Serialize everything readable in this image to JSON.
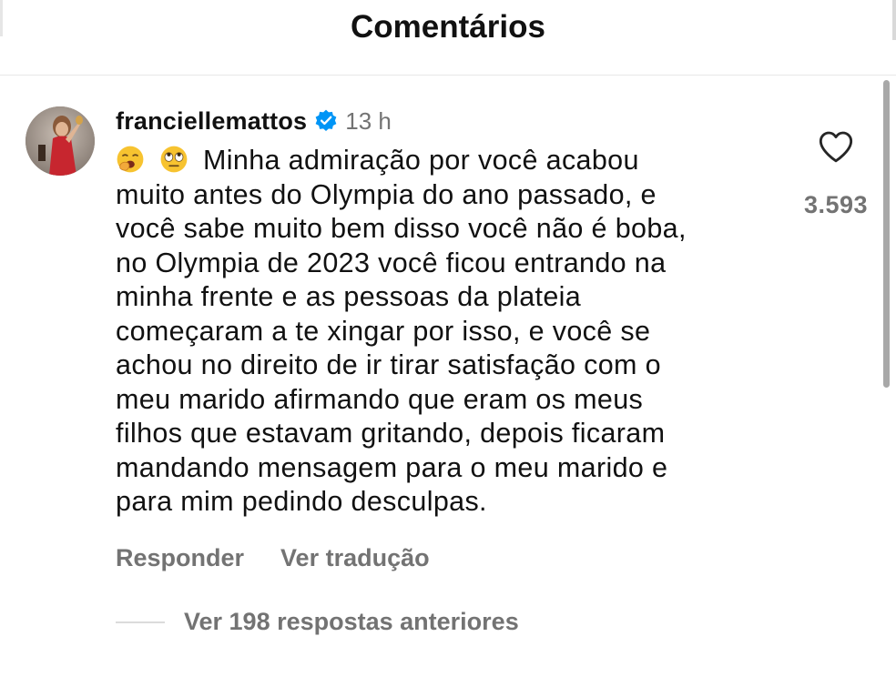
{
  "header": {
    "title": "Comentários"
  },
  "comment": {
    "username": "franciellemattos",
    "time": "13 h",
    "emojis": [
      "yawning-face",
      "face-with-rolling-eyes"
    ],
    "text": "Minha admiração por você acabou\nmuito antes do Olympia do ano passado, e\nvocê sabe muito bem disso você não é boba,\nno Olympia de 2023 você ficou entrando na\nminha frente e as pessoas da plateia\ncomeçaram a te xingar por isso, e você se\nachou no direito de ir tirar satisfação com o\nmeu marido afirmando que eram os meus\nfilhos que estavam gritando, depois ficaram\nmandando mensagem para o meu marido e\npara mim pedindo desculpas.",
    "likes": "3.593",
    "actions": {
      "reply": "Responder",
      "translate": "Ver tradução"
    },
    "view_replies": "Ver 198 respostas anteriores"
  },
  "colors": {
    "verified_badge": "#0095f6",
    "secondary_text": "#737373",
    "divider": "#e7e7e7"
  }
}
